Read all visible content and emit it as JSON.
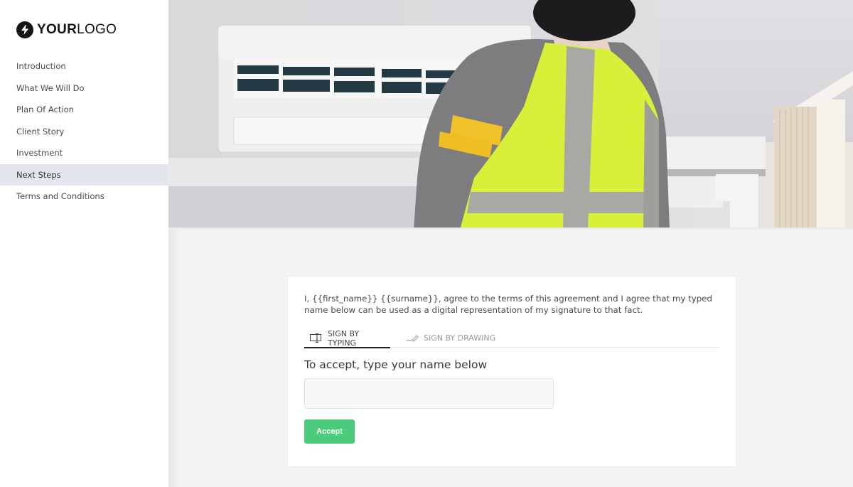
{
  "logo": {
    "bold": "YOUR",
    "light": "LOGO",
    "icon": "lightning-bolt-icon"
  },
  "sidebar": {
    "items": [
      {
        "label": "Introduction",
        "active": false
      },
      {
        "label": "What We Will Do",
        "active": false
      },
      {
        "label": "Plan Of Action",
        "active": false
      },
      {
        "label": "Client Story",
        "active": false
      },
      {
        "label": "Investment",
        "active": false
      },
      {
        "label": "Next Steps",
        "active": true
      },
      {
        "label": "Terms and Conditions",
        "active": false
      }
    ]
  },
  "hero": {
    "description": "Technician in high-visibility vest inspecting a wall-mounted air conditioner"
  },
  "signature": {
    "agreement_text": "I, {{first_name}} {{surname}}, agree to the terms of this agreement and I agree that my typed name below can be used as a digital representation of my signature to that fact.",
    "tabs": [
      {
        "label": "SIGN BY TYPING",
        "icon": "text-cursor-icon",
        "active": true
      },
      {
        "label": "SIGN BY DRAWING",
        "icon": "pen-icon",
        "active": false
      }
    ],
    "accept_label": "To accept, type your name below",
    "name_input": {
      "value": "",
      "placeholder": ""
    },
    "accept_button": "Accept"
  },
  "colors": {
    "accent_green": "#4bcb7c",
    "active_nav_bg": "#e3e6ec",
    "vest_yellow": "#d9f03a"
  }
}
